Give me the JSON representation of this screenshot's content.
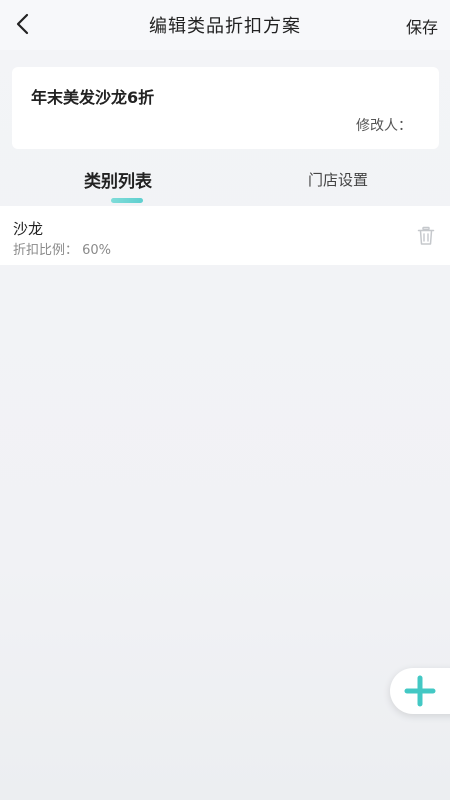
{
  "header": {
    "title": "编辑类品折扣方案",
    "save_label": "保存"
  },
  "plan": {
    "name": "年末美发沙龙6折",
    "modifier_label": "修改人："
  },
  "tabs": {
    "categories_label": "类别列表",
    "stores_label": "门店设置"
  },
  "list": {
    "items": [
      {
        "name": "沙龙",
        "discount": "折扣比例：  60%"
      }
    ]
  },
  "icons": {
    "back": "back-arrow-icon",
    "delete": "trash-icon",
    "add": "plus-icon"
  },
  "colors": {
    "accent": "#43c8c4",
    "background": "#f2f3f6"
  }
}
